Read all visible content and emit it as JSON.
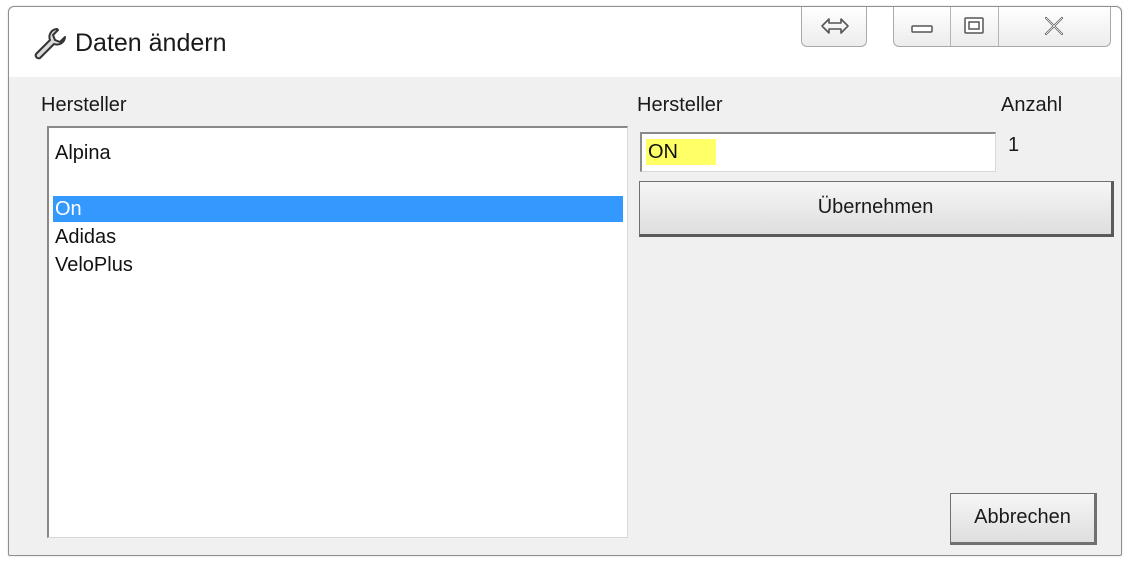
{
  "window": {
    "title": "Daten ändern",
    "title_icon": "wrench-icon",
    "controls": [
      "resize-arrows-icon",
      "minimize-icon",
      "maximize-icon",
      "close-icon"
    ]
  },
  "left": {
    "header": "Hersteller",
    "items": [
      {
        "label": "Alpina",
        "selected": false
      },
      {
        "label": "",
        "selected": false
      },
      {
        "label": "On",
        "selected": true
      },
      {
        "label": "Adidas",
        "selected": false
      },
      {
        "label": "VeloPlus",
        "selected": false
      }
    ]
  },
  "right": {
    "hersteller_label": "Hersteller",
    "anzahl_label": "Anzahl",
    "anzahl_value": "1",
    "hersteller_value": "ON",
    "highlight_color": "#ffff66"
  },
  "buttons": {
    "apply_label": "Übernehmen",
    "cancel_label": "Abbrechen"
  },
  "colors": {
    "selection": "#3399ff"
  }
}
